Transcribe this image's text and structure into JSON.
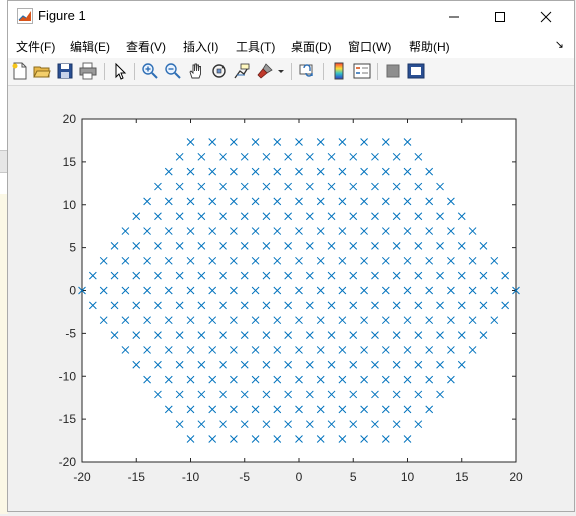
{
  "window": {
    "title": "Figure 1"
  },
  "menubar": {
    "items": [
      "文件(F)",
      "编辑(E)",
      "查看(V)",
      "插入(I)",
      "工具(T)",
      "桌面(D)",
      "窗口(W)",
      "帮助(H)"
    ],
    "overflow_glyph": "↘"
  },
  "toolbar": {
    "icons": [
      "new-figure-icon",
      "open-file-icon",
      "save-icon",
      "print-icon",
      "select-arrow-icon",
      "zoom-in-icon",
      "zoom-out-icon",
      "pan-hand-icon",
      "rotate-3d-icon",
      "data-cursor-icon",
      "brush-icon",
      "brush-dropdown-icon",
      "link-plot-icon",
      "colorbar-icon",
      "legend-icon",
      "hide-plot-tools-icon",
      "show-plot-tools-icon"
    ]
  },
  "chart_data": {
    "type": "scatter",
    "marker": "x",
    "marker_color": "#0072bd",
    "title": "",
    "xlabel": "",
    "ylabel": "",
    "xlim": [
      -20,
      20
    ],
    "ylim": [
      -20,
      20
    ],
    "xticks": [
      -20,
      -15,
      -10,
      -5,
      0,
      5,
      10,
      15,
      20
    ],
    "yticks": [
      -20,
      -15,
      -10,
      -5,
      0,
      5,
      10,
      15,
      20
    ],
    "grid": false,
    "pattern": "hexagonal lattice of points clipped to a hexagon of radius 20",
    "x_spacing": 2,
    "y_spacing": 1.732,
    "row_count": 21,
    "points": [
      {
        "y": 17.32,
        "x": [
          -10,
          -8,
          -6,
          -4,
          -2,
          0,
          2,
          4,
          6,
          8,
          10
        ]
      },
      {
        "y": 15.59,
        "x": [
          -11,
          -9,
          -7,
          -5,
          -3,
          -1,
          1,
          3,
          5,
          7,
          9,
          11
        ]
      },
      {
        "y": 13.86,
        "x": [
          -12,
          -10,
          -8,
          -6,
          -4,
          -2,
          0,
          2,
          4,
          6,
          8,
          10,
          12
        ]
      },
      {
        "y": 12.12,
        "x": [
          -13,
          -11,
          -9,
          -7,
          -5,
          -3,
          -1,
          1,
          3,
          5,
          7,
          9,
          11,
          13
        ]
      },
      {
        "y": 10.39,
        "x": [
          -14,
          -12,
          -10,
          -8,
          -6,
          -4,
          -2,
          0,
          2,
          4,
          6,
          8,
          10,
          12,
          14
        ]
      },
      {
        "y": 8.66,
        "x": [
          -15,
          -13,
          -11,
          -9,
          -7,
          -5,
          -3,
          -1,
          1,
          3,
          5,
          7,
          9,
          11,
          13,
          15
        ]
      },
      {
        "y": 6.93,
        "x": [
          -16,
          -14,
          -12,
          -10,
          -8,
          -6,
          -4,
          -2,
          0,
          2,
          4,
          6,
          8,
          10,
          12,
          14,
          16
        ]
      },
      {
        "y": 5.2,
        "x": [
          -17,
          -15,
          -13,
          -11,
          -9,
          -7,
          -5,
          -3,
          -1,
          1,
          3,
          5,
          7,
          9,
          11,
          13,
          15,
          17
        ]
      },
      {
        "y": 3.46,
        "x": [
          -18,
          -16,
          -14,
          -12,
          -10,
          -8,
          -6,
          -4,
          -2,
          0,
          2,
          4,
          6,
          8,
          10,
          12,
          14,
          16,
          18
        ]
      },
      {
        "y": 1.73,
        "x": [
          -19,
          -17,
          -15,
          -13,
          -11,
          -9,
          -7,
          -5,
          -3,
          -1,
          1,
          3,
          5,
          7,
          9,
          11,
          13,
          15,
          17,
          19
        ]
      },
      {
        "y": 0,
        "x": [
          -20,
          -18,
          -16,
          -14,
          -12,
          -10,
          -8,
          -6,
          -4,
          -2,
          0,
          2,
          4,
          6,
          8,
          10,
          12,
          14,
          16,
          18,
          20
        ]
      },
      {
        "y": -1.73,
        "x": [
          -19,
          -17,
          -15,
          -13,
          -11,
          -9,
          -7,
          -5,
          -3,
          -1,
          1,
          3,
          5,
          7,
          9,
          11,
          13,
          15,
          17,
          19
        ]
      },
      {
        "y": -3.46,
        "x": [
          -18,
          -16,
          -14,
          -12,
          -10,
          -8,
          -6,
          -4,
          -2,
          0,
          2,
          4,
          6,
          8,
          10,
          12,
          14,
          16,
          18
        ]
      },
      {
        "y": -5.2,
        "x": [
          -17,
          -15,
          -13,
          -11,
          -9,
          -7,
          -5,
          -3,
          -1,
          1,
          3,
          5,
          7,
          9,
          11,
          13,
          15,
          17
        ]
      },
      {
        "y": -6.93,
        "x": [
          -16,
          -14,
          -12,
          -10,
          -8,
          -6,
          -4,
          -2,
          0,
          2,
          4,
          6,
          8,
          10,
          12,
          14,
          16
        ]
      },
      {
        "y": -8.66,
        "x": [
          -15,
          -13,
          -11,
          -9,
          -7,
          -5,
          -3,
          -1,
          1,
          3,
          5,
          7,
          9,
          11,
          13,
          15
        ]
      },
      {
        "y": -10.39,
        "x": [
          -14,
          -12,
          -10,
          -8,
          -6,
          -4,
          -2,
          0,
          2,
          4,
          6,
          8,
          10,
          12,
          14
        ]
      },
      {
        "y": -12.12,
        "x": [
          -13,
          -11,
          -9,
          -7,
          -5,
          -3,
          -1,
          1,
          3,
          5,
          7,
          9,
          11,
          13
        ]
      },
      {
        "y": -13.86,
        "x": [
          -12,
          -10,
          -8,
          -6,
          -4,
          -2,
          0,
          2,
          4,
          6,
          8,
          10,
          12
        ]
      },
      {
        "y": -15.59,
        "x": [
          -11,
          -9,
          -7,
          -5,
          -3,
          -1,
          1,
          3,
          5,
          7,
          9,
          11
        ]
      },
      {
        "y": -17.32,
        "x": [
          -10,
          -8,
          -6,
          -4,
          -2,
          0,
          2,
          4,
          6,
          8,
          10
        ]
      }
    ]
  }
}
